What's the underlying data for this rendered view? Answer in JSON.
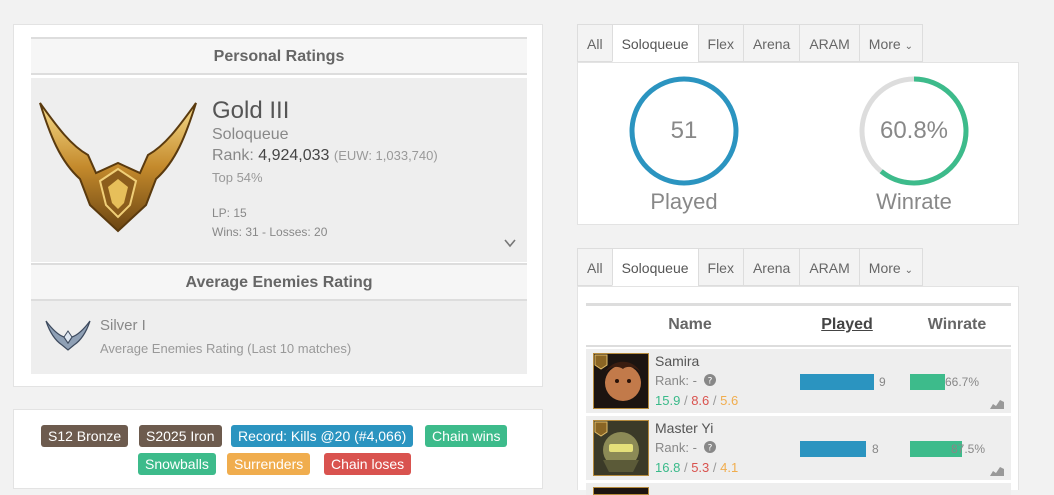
{
  "personal": {
    "title": "Personal Ratings",
    "tier": "Gold III",
    "queue": "Soloqueue",
    "rank_label": "Rank:",
    "rank_value": "4,924,033",
    "rank_euw": "(EUW: 1,033,740)",
    "top": "Top 54%",
    "lp": "LP: 15",
    "wins_losses": "Wins: 31 - Losses: 20",
    "emblem_icon": "gold-emblem-icon"
  },
  "enemies": {
    "title": "Average Enemies Rating",
    "tier": "Silver I",
    "sub": "Average Enemies Rating (Last 10 matches)"
  },
  "badges": [
    {
      "label": "S12 Bronze",
      "color": "#6d5b4e"
    },
    {
      "label": "S2025 Iron",
      "color": "#6d5b4e"
    },
    {
      "label": "Record: Kills @20 (#4,066)",
      "color": "#2b94c0"
    },
    {
      "label": "Chain wins",
      "color": "#3dbb8b"
    },
    {
      "label": "Snowballs",
      "color": "#3dbb8b"
    },
    {
      "label": "Surrenders",
      "color": "#f0ad4e"
    },
    {
      "label": "Chain loses",
      "color": "#d9534f"
    }
  ],
  "tabs": [
    "All",
    "Soloqueue",
    "Flex",
    "Arena",
    "ARAM",
    "More"
  ],
  "active_tab": "Soloqueue",
  "stats": {
    "played_value": "51",
    "played_label": "Played",
    "winrate_value": "60.8%",
    "winrate_label": "Winrate",
    "winrate_fraction": 0.608,
    "played_color": "#2b94c0",
    "win_color": "#3dbb8b"
  },
  "champ_table": {
    "headers": {
      "name": "Name",
      "played": "Played",
      "winrate": "Winrate"
    },
    "rows": [
      {
        "name": "Samira",
        "rank": "Rank: -",
        "k": "15.9",
        "d": "8.6",
        "a": "5.6",
        "played": 9,
        "winrate": "66.7%",
        "winrate_fraction": 0.667
      },
      {
        "name": "Master Yi",
        "rank": "Rank: -",
        "k": "16.8",
        "d": "5.3",
        "a": "4.1",
        "played": 8,
        "winrate": "87.5%",
        "winrate_fraction": 0.875
      }
    ],
    "max_played": 9
  }
}
